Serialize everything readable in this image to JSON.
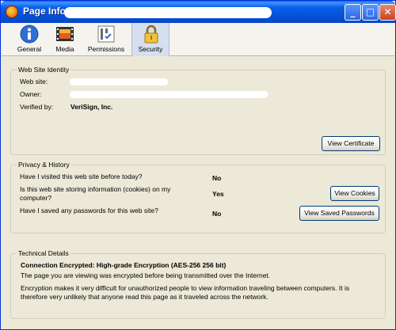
{
  "window": {
    "title": "Page Info -",
    "minimize": "_",
    "maximize": "□",
    "close": "✕"
  },
  "tabs": [
    {
      "label": "General",
      "icon": "info-icon"
    },
    {
      "label": "Media",
      "icon": "film-icon"
    },
    {
      "label": "Permissions",
      "icon": "permissions-icon"
    },
    {
      "label": "Security",
      "icon": "lock-icon",
      "selected": true
    }
  ],
  "identity": {
    "title": "Web Site Identity",
    "website_label": "Web site:",
    "owner_label": "Owner:",
    "verified_label": "Verified by:",
    "verified_value": "VeriSign, Inc.",
    "view_certificate": "View Certificate"
  },
  "privacy": {
    "title": "Privacy & History",
    "q1": "Have I visited this web site before today?",
    "a1": "No",
    "q2_line1": "Is this web site storing information (cookies) on my",
    "q2_line2": "computer?",
    "a2": "Yes",
    "q3": "Have I saved any passwords for this web site?",
    "a3": "No",
    "view_cookies": "View Cookies",
    "view_passwords": "View Saved Passwords"
  },
  "technical": {
    "title": "Technical Details",
    "heading": "Connection Encrypted: High-grade Encryption (AES-256 256 bit)",
    "line1": "The page you are viewing was encrypted before being transmitted over the Internet.",
    "line2a": "Encryption makes it very difficult for unauthorized people to view information traveling between computers. It is",
    "line2b": "therefore very unlikely that anyone read this page as it traveled across the network."
  }
}
